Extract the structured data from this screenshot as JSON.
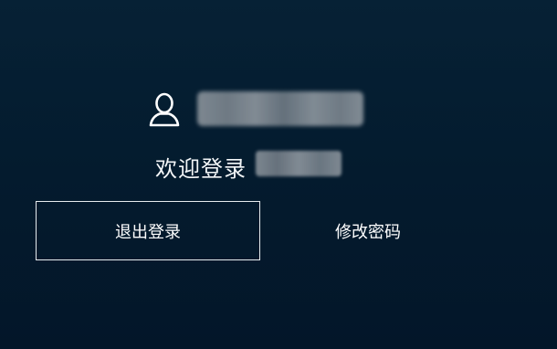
{
  "user": {
    "icon": "user-icon",
    "username_redacted": ""
  },
  "welcome": {
    "text": "欢迎登录",
    "name_redacted": ""
  },
  "actions": {
    "logout_label": "退出登录",
    "change_password_label": "修改密码"
  },
  "colors": {
    "background_top": "#062135",
    "background_bottom": "#031629",
    "text": "#ffffff",
    "button_border": "#e8ecef"
  }
}
